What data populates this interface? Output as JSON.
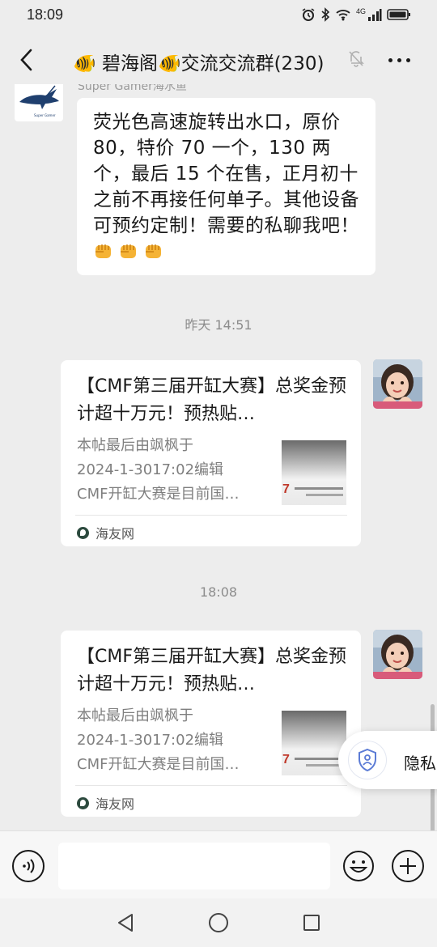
{
  "status_bar": {
    "time": "18:09",
    "network_label": "4G"
  },
  "header": {
    "title": "🐠 碧海阁🐠交流交流群(230)",
    "back_icon": "chevron-left-icon",
    "mute_icon": "bell-off-icon",
    "more_icon": "more-dots-icon"
  },
  "messages": {
    "first": {
      "sender_name": "Super Gamer海水鱼",
      "avatar_logo_text": "Super Gamer",
      "text": "荧光色高速旋转出水口，原价80，特价 70 一个，130 两个，最后 15 个在售，正月初十之前不再接任何单子。其他设备可预约定制！需要的私聊我吧！",
      "emoji_count": 3,
      "emoji_icon": "fist-icon"
    },
    "time_1": "昨天 14:51",
    "card_1": {
      "title": "【CMF第三届开缸大赛】总奖金预计超十万元！预热贴…",
      "desc_line_1": "本帖最后由飒枫于",
      "desc_line_2": "2024-1-3017:02编辑",
      "desc_line_3": "CMF开缸大赛是目前国…",
      "thumb_text": "7",
      "source": "海友网"
    },
    "time_2": "18:08",
    "card_2": {
      "title": "【CMF第三届开缸大赛】总奖金预计超十万元！预热贴…",
      "desc_line_1": "本帖最后由飒枫于",
      "desc_line_2": "2024-1-3017:02编辑",
      "desc_line_3": "CMF开缸大赛是目前国…",
      "thumb_text": "7",
      "source": "海友网"
    }
  },
  "privacy_pill": {
    "label": "隐私",
    "icon": "shield-person-icon"
  },
  "input_bar": {
    "voice_icon": "voice-icon",
    "placeholder": "",
    "emoji_icon": "smiley-icon",
    "plus_icon": "plus-icon"
  },
  "system_nav": {
    "back_icon": "triangle-back-icon",
    "home_icon": "circle-home-icon",
    "recent_icon": "square-recent-icon"
  },
  "colors": {
    "background": "#ededed",
    "bubble": "#ffffff",
    "text": "#191919",
    "muted_text": "#8c8c8c"
  }
}
